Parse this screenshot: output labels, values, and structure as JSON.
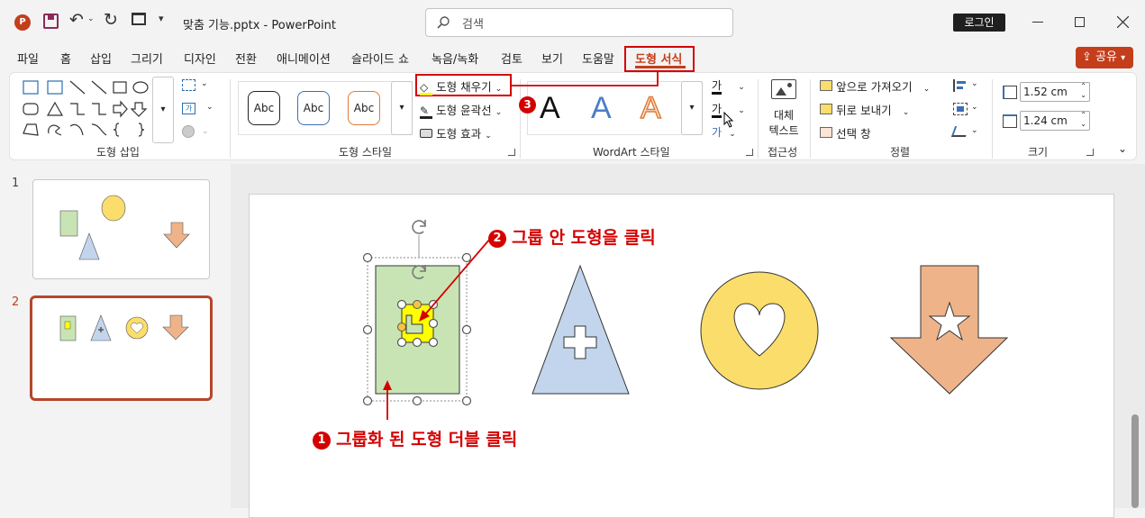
{
  "titlebar": {
    "filename": "맞춤 기능.pptx",
    "separator": "-",
    "app": "PowerPoint",
    "search_placeholder": "검색",
    "login": "로그인"
  },
  "menu": {
    "items": [
      "파일",
      "홈",
      "삽입",
      "그리기",
      "디자인",
      "전환",
      "애니메이션",
      "슬라이드 쇼",
      "녹음/녹화",
      "검토",
      "보기",
      "도움말",
      "도형 서식"
    ],
    "share": "공유"
  },
  "ribbon": {
    "groups": {
      "insert_shapes": "도형 삽입",
      "shape_styles": "도형 스타일",
      "wordart_styles": "WordArt 스타일",
      "accessibility": "접근성",
      "arrange": "정렬",
      "size": "크기"
    },
    "style_samples": [
      "Abc",
      "Abc",
      "Abc"
    ],
    "shape_fill": "도형 채우기",
    "shape_outline": "도형 윤곽선",
    "shape_effects": "도형 효과",
    "wordart_letter": "A",
    "text_fill_glyph": "가",
    "alt_text_line1": "대체",
    "alt_text_line2": "텍스트",
    "bring_forward": "앞으로 가져오기",
    "send_backward": "뒤로 보내기",
    "selection_pane": "선택 창",
    "height": "1.52 cm",
    "width": "1.24 cm"
  },
  "slides": {
    "numbers": [
      "1",
      "2"
    ]
  },
  "annotations": {
    "step1": "그룹화 된 도형 더블 클릭",
    "step1_num": "1",
    "step2": "그룹 안 도형을 클릭",
    "step2_num": "2",
    "step3_num": "3"
  },
  "colors": {
    "accent": "#c43e1c",
    "annotation_red": "#d40000",
    "rect_green": "#c9e4b4",
    "triangle_blue": "#c2d5ec",
    "circle_yellow": "#fbdd6b",
    "arrow_orange": "#efb38a",
    "selected_yellow": "#ffff00"
  }
}
